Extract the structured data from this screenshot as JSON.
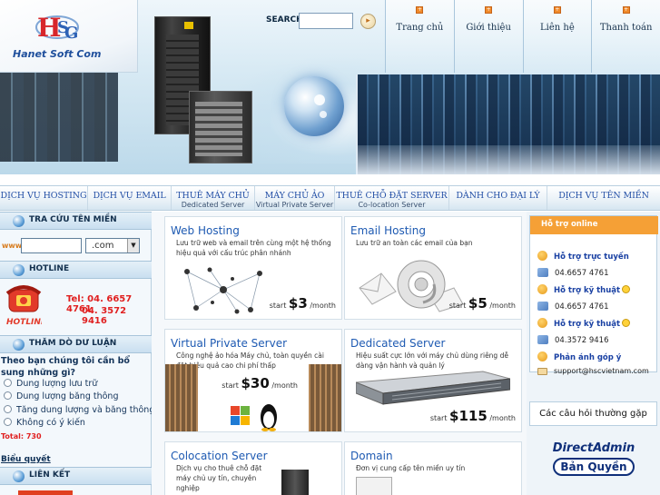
{
  "brand": {
    "logo_text": "Hanet Soft Com",
    "accent": "#1f4f9c",
    "logo_colors": [
      "#d7262b",
      "#2d61b5"
    ]
  },
  "search": {
    "label": "SEARCH",
    "value": "",
    "go_icon": "arrow-right-icon"
  },
  "top_nav": [
    "Trang chủ",
    "Giới thiệu",
    "Liên hệ",
    "Thanh toán"
  ],
  "main_nav": [
    {
      "label": "DỊCH VỤ HOSTING",
      "sub": ""
    },
    {
      "label": "DỊCH VỤ EMAIL",
      "sub": ""
    },
    {
      "label": "THUÊ MÁY CHỦ",
      "sub": "Dedicated Server"
    },
    {
      "label": "MÁY CHỦ ẢO",
      "sub": "Virtual Private Server"
    },
    {
      "label": "THUÊ CHỖ ĐẶT SERVER",
      "sub": "Co-location Server"
    },
    {
      "label": "DÀNH CHO ĐẠI LÝ",
      "sub": ""
    },
    {
      "label": "DỊCH VỤ TÊN MIỀN",
      "sub": ""
    }
  ],
  "left": {
    "domain_head": "TRA CỨU TÊN MIỀN",
    "domain_prefix": "www",
    "domain_value": "",
    "domain_tld": ".com",
    "hotline_head": "HOTLINE",
    "hotline_1": "Tel: 04. 6657 4761",
    "hotline_2": "04. 3572 9416",
    "poll_head": "THĂM DÒ DƯ LUẬN",
    "poll_question": "Theo bạn chúng tôi cần bổ sung những gì?",
    "poll_options": [
      "Dung lượng lưu trữ",
      "Dung lượng băng thông",
      "Tăng dung lượng và băng thông",
      "Không có ý kiến"
    ],
    "poll_total": "Total: 730",
    "poll_link": "Biểu quyết",
    "links_head": "LIÊN KẾT"
  },
  "services": [
    {
      "title": "Web Hosting",
      "desc": "Lưu trữ web và email trên cùng một hệ thống hiệu quả với cấu trúc phân nhánh",
      "price_prefix": "start",
      "price": "$3",
      "price_suffix": "/month"
    },
    {
      "title": "Email Hosting",
      "desc": "Lưu trữ an toàn các email của bạn",
      "price_prefix": "start",
      "price": "$5",
      "price_suffix": "/month"
    },
    {
      "title": "Virtual Private Server",
      "desc": "Công nghệ ảo hóa Máy chủ, toàn quyền cài đặt hiệu quả cao chi phí thấp",
      "price_prefix": "start",
      "price": "$30",
      "price_suffix": "/month"
    },
    {
      "title": "Dedicated Server",
      "desc": "Hiệu suất cực lớn với máy chủ dùng riêng dễ dàng vận hành và quản lý",
      "price_prefix": "start",
      "price": "$115",
      "price_suffix": "/month"
    },
    {
      "title": "Colocation Server",
      "desc": "Dịch vụ cho thuê chỗ đặt máy chủ uy tín, chuyên nghiệp",
      "price_prefix": "",
      "price": "",
      "price_suffix": ""
    },
    {
      "title": "Domain",
      "desc": "Đơn vị cung cấp tên miền uy tín",
      "price_prefix": "",
      "price": "",
      "price_suffix": ""
    }
  ],
  "support": {
    "title": "Hỗ trợ online",
    "rows": [
      {
        "text": "Hỗ trợ trực tuyến",
        "kind": "link",
        "icon": "person-icon"
      },
      {
        "text": "04.6657 4761",
        "kind": "phone",
        "icon": "phone-icon"
      },
      {
        "text": "Hỗ trợ kỹ thuật",
        "kind": "link",
        "icon": "person-icon"
      },
      {
        "text": "04.6657 4761",
        "kind": "phone",
        "icon": "phone-icon"
      },
      {
        "text": "Hỗ trợ kỹ thuật",
        "kind": "link",
        "icon": "person-icon"
      },
      {
        "text": "04.3572 9416",
        "kind": "phone",
        "icon": "phone-icon"
      },
      {
        "text": "Phản ánh góp ý",
        "kind": "link",
        "icon": "person-icon"
      },
      {
        "text": "support@hscvietnam.com",
        "kind": "email",
        "icon": "mail-icon"
      }
    ],
    "faq": "Các câu hỏi thường gặp",
    "da_line1": "DirectAdmin",
    "da_line2": "Bản Quyền"
  }
}
